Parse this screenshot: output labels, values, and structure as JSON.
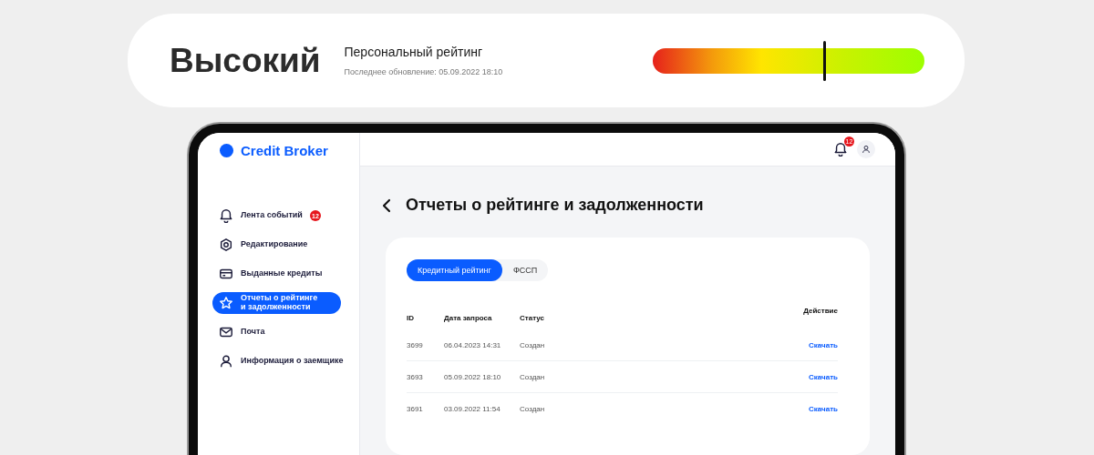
{
  "rating": {
    "value_label": "Высокий",
    "title": "Персональный рейтинг",
    "updated": "Последнее обновление: 05.09.2022 18:10",
    "level": 0.63
  },
  "app": {
    "logo": "Credit Broker",
    "notifications_badge": "12"
  },
  "sidebar": {
    "items": [
      {
        "label": "Лента событий",
        "kind": "bell",
        "badge": "12",
        "selected": false
      },
      {
        "label": "Редактирование",
        "kind": "gear",
        "selected": false
      },
      {
        "label": "Выданные кредиты",
        "kind": "card",
        "selected": false
      },
      {
        "label": "Отчеты о рейтинге\nи задолженности",
        "kind": "star",
        "selected": true
      },
      {
        "label": "Почта",
        "kind": "mail",
        "selected": false
      },
      {
        "label": "Информация о заемщике",
        "kind": "user",
        "selected": false
      }
    ]
  },
  "page": {
    "title": "Отчеты о рейтинге и задолженности",
    "tabs": [
      {
        "label": "Кредитный рейтинг",
        "selected": true
      },
      {
        "label": "ФССП",
        "selected": false
      }
    ],
    "table": {
      "columns": [
        "ID",
        "Дата запроса",
        "Статус",
        "Действие"
      ],
      "rows": [
        {
          "id": "3699",
          "date": "06.04.2023 14:31",
          "status": "Создан",
          "action": "Скачать"
        },
        {
          "id": "3693",
          "date": "05.09.2022 18:10",
          "status": "Создан",
          "action": "Скачать"
        },
        {
          "id": "3691",
          "date": "03.09.2022 11:54",
          "status": "Создан",
          "action": "Скачать"
        }
      ]
    }
  }
}
